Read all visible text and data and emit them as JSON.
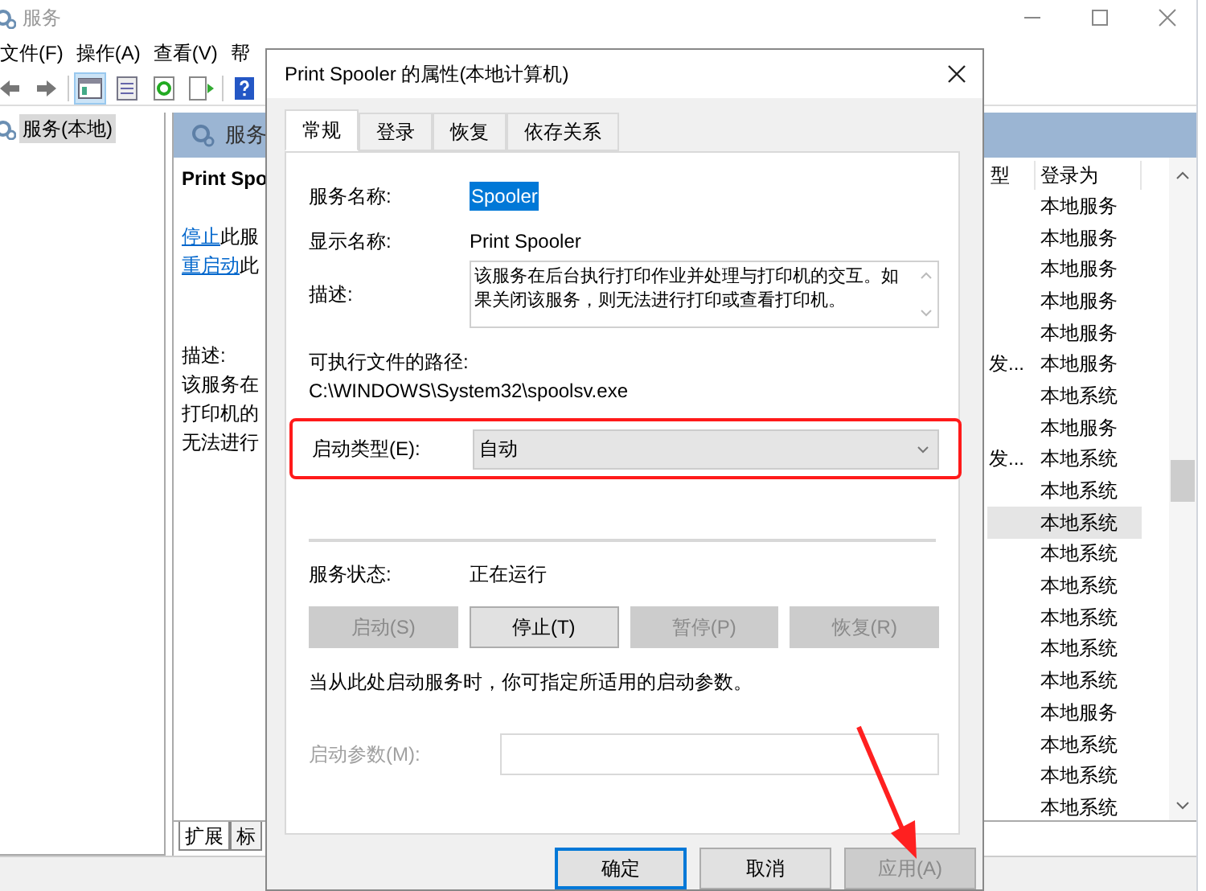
{
  "window": {
    "title": "服务"
  },
  "menu": [
    "文件(F)",
    "操作(A)",
    "查看(V)",
    "帮"
  ],
  "toolbar": [
    {
      "kind": "back"
    },
    {
      "kind": "forward"
    },
    {
      "kind": "console",
      "selected": true
    },
    {
      "kind": "list",
      "selected": false
    },
    {
      "kind": "refresh",
      "selected": false
    },
    {
      "kind": "export",
      "selected": false
    },
    {
      "kind": "help",
      "selected": false
    }
  ],
  "tree": {
    "items": [
      {
        "label": "服务(本地)",
        "selected": true
      }
    ]
  },
  "panel": {
    "header": "服务",
    "service_title": "Print Spo",
    "actions": [
      {
        "link": "停止",
        "text": "此服"
      },
      {
        "link": "重启动",
        "text": "此"
      }
    ],
    "description_label": "描述:",
    "description_lines": [
      "该服务在",
      "打印机的",
      "无法进行"
    ],
    "columns": [
      "型",
      "登录为"
    ],
    "rows": [
      {
        "column_1": "",
        "logon": "本地服务",
        "selected": false
      },
      {
        "column_1": "",
        "logon": "本地服务",
        "selected": false
      },
      {
        "column_1": "",
        "logon": "本地服务",
        "selected": false
      },
      {
        "column_1": "",
        "logon": "本地服务",
        "selected": false
      },
      {
        "column_1": "",
        "logon": "本地服务",
        "selected": false
      },
      {
        "column_1": "发...",
        "logon": "本地服务",
        "selected": false
      },
      {
        "column_1": "",
        "logon": "本地系统",
        "selected": false
      },
      {
        "column_1": "",
        "logon": "本地服务",
        "selected": false
      },
      {
        "column_1": "发...",
        "logon": "本地系统",
        "selected": false
      },
      {
        "column_1": "",
        "logon": "本地系统",
        "selected": false
      },
      {
        "column_1": "",
        "logon": "本地系统",
        "selected": true
      },
      {
        "column_1": "",
        "logon": "本地系统",
        "selected": false
      },
      {
        "column_1": "",
        "logon": "本地系统",
        "selected": false
      },
      {
        "column_1": "",
        "logon": "本地系统",
        "selected": false
      },
      {
        "column_1": "",
        "logon": "本地系统",
        "selected": false
      },
      {
        "column_1": "",
        "logon": "本地系统",
        "selected": false
      },
      {
        "column_1": "",
        "logon": "本地服务",
        "selected": false
      },
      {
        "column_1": "",
        "logon": "本地系统",
        "selected": false
      },
      {
        "column_1": "",
        "logon": "本地系统",
        "selected": false
      },
      {
        "column_1": "",
        "logon": "本地系统",
        "selected": false
      }
    ],
    "view_tabs": [
      {
        "label": "扩展",
        "selected": true
      },
      {
        "label": "标",
        "selected": false
      }
    ]
  },
  "dialog": {
    "title": "Print Spooler 的属性(本地计算机)",
    "tabs": [
      {
        "label": "常规",
        "selected": true
      },
      {
        "label": "登录",
        "selected": false
      },
      {
        "label": "恢复",
        "selected": false
      },
      {
        "label": "依存关系",
        "selected": false
      }
    ],
    "service_name": {
      "label": "服务名称:",
      "value": "Spooler",
      "selected": true
    },
    "display_name": {
      "label": "显示名称:",
      "value": "Print Spooler"
    },
    "description": {
      "label": "描述:",
      "value": "该服务在后台执行打印作业并处理与打印机的交互。如果关闭该服务，则无法进行打印或查看打印机。"
    },
    "path": {
      "label": "可执行文件的路径:",
      "value": "C:\\WINDOWS\\System32\\spoolsv.exe"
    },
    "startup_type": {
      "label": "启动类型(E):",
      "value": "自动",
      "highlighted": true
    },
    "status": {
      "label": "服务状态:",
      "value": "正在运行"
    },
    "service_buttons": [
      {
        "label": "启动(S)",
        "disabled": true
      },
      {
        "label": "停止(T)",
        "disabled": false
      },
      {
        "label": "暂停(P)",
        "disabled": true
      },
      {
        "label": "恢复(R)",
        "disabled": true
      }
    ],
    "note": "当从此处启动服务时，你可指定所适用的启动参数。",
    "parameters": {
      "label": "启动参数(M):",
      "disabled": true
    },
    "buttons": [
      {
        "label": "确定",
        "default": true,
        "disabled": false
      },
      {
        "label": "取消",
        "default": false,
        "disabled": false
      },
      {
        "label": "应用(A)",
        "default": false,
        "disabled": true
      }
    ]
  },
  "annotations": [
    {
      "kind": "arrow"
    }
  ]
}
